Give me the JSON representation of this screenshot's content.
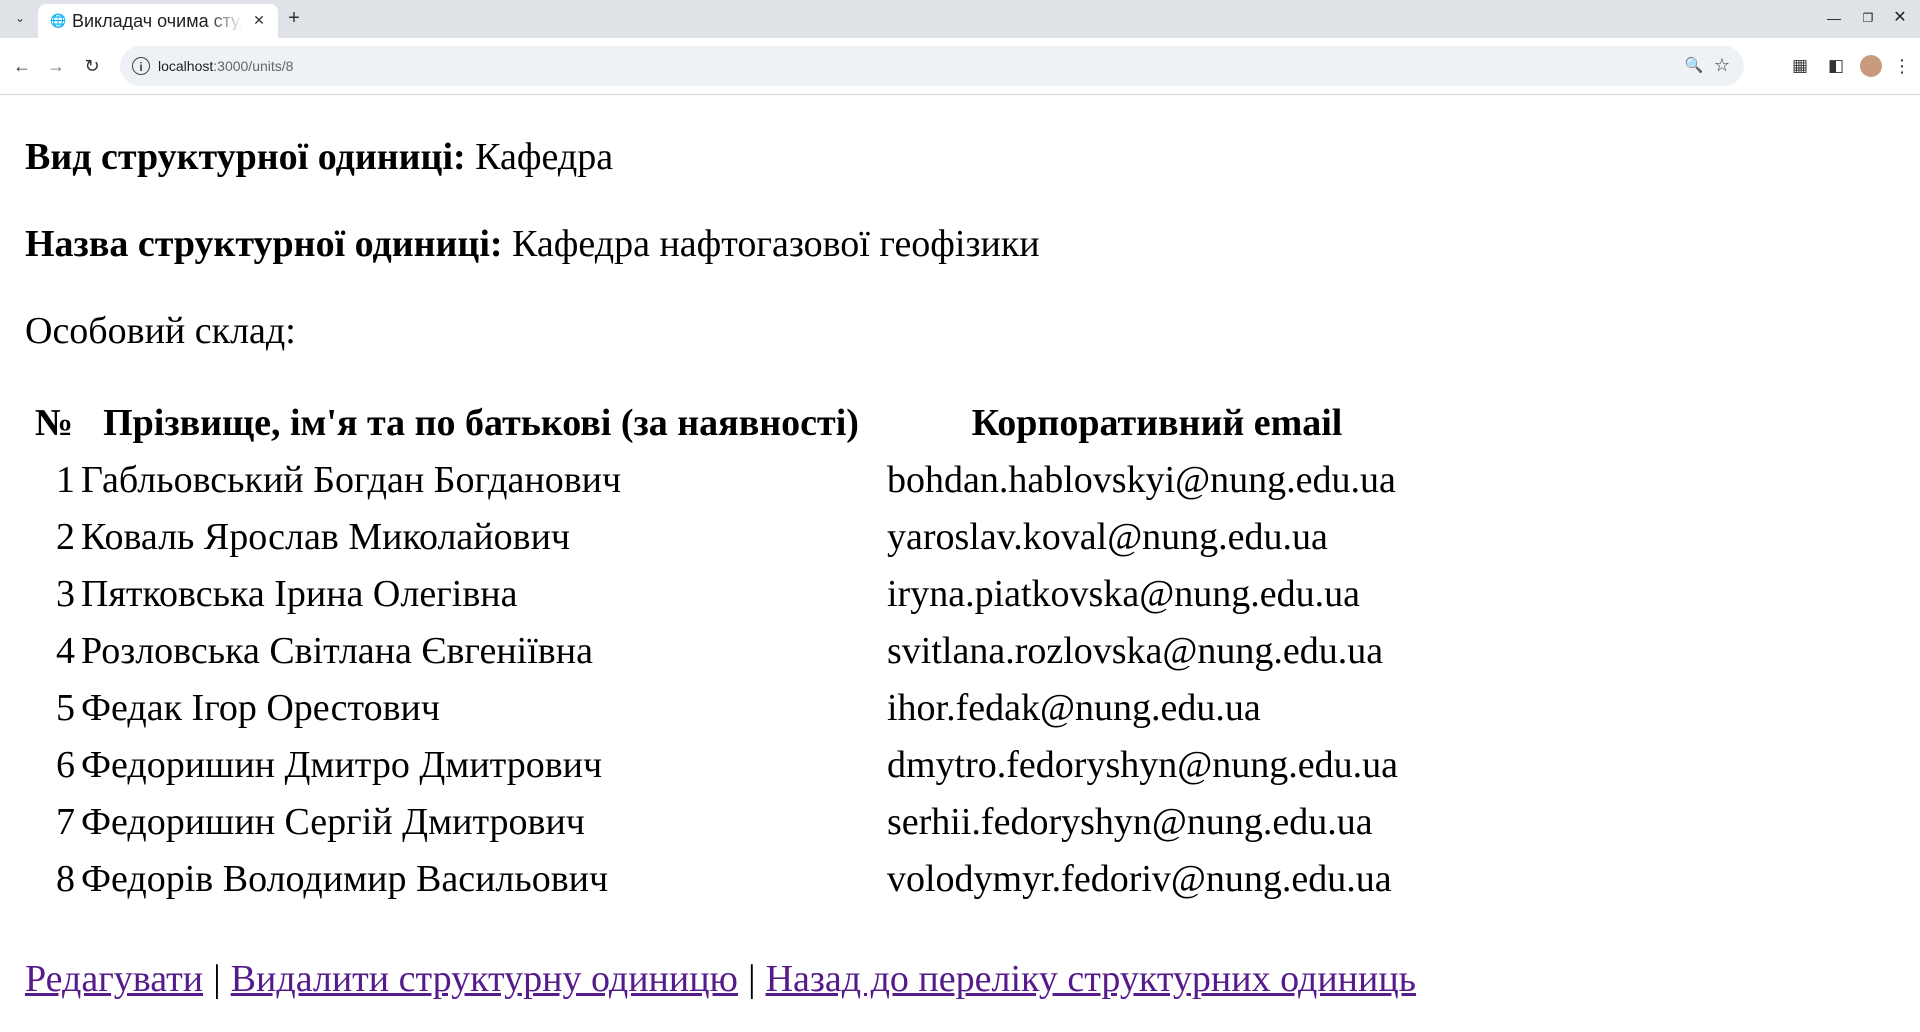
{
  "browser": {
    "tab_title": "Викладач очима студента",
    "url_host": "localhost",
    "url_path": ":3000/units/8",
    "icons": {
      "tab_list": "chevron-down-icon",
      "favicon": "globe-icon",
      "close": "close-icon",
      "new_tab": "plus-icon",
      "back": "arrow-left-icon",
      "forward": "arrow-right-icon",
      "reload": "reload-icon",
      "site_info": "info-icon",
      "zoom": "zoom-icon",
      "bookmark": "star-icon",
      "extensions": "puzzle-icon",
      "side_panel": "side-panel-icon",
      "profile": "avatar",
      "menu": "kebab-menu-icon"
    }
  },
  "unit": {
    "type_label": "Вид структурної одиниці:",
    "type_value": "Кафедра",
    "name_label": "Назва структурної одиниці:",
    "name_value": "Кафедра нафтогазової геофізики",
    "staff_heading": "Особовий склад:"
  },
  "staff_table": {
    "headers": {
      "num": "№",
      "name": "Прізвище, ім'я та по батькові (за наявності)",
      "email": "Корпоративний email"
    },
    "rows": [
      {
        "num": "1",
        "name": "Габльовський Богдан Богданович",
        "email": "bohdan.hablovskyi@nung.edu.ua"
      },
      {
        "num": "2",
        "name": "Коваль Ярослав Миколайович",
        "email": "yaroslav.koval@nung.edu.ua"
      },
      {
        "num": "3",
        "name": "Пятковська Ірина Олегівна",
        "email": "iryna.piatkovska@nung.edu.ua"
      },
      {
        "num": "4",
        "name": "Розловська Світлана Євгеніївна",
        "email": "svitlana.rozlovska@nung.edu.ua"
      },
      {
        "num": "5",
        "name": "Федак Ігор Орестович",
        "email": "ihor.fedak@nung.edu.ua"
      },
      {
        "num": "6",
        "name": "Федоришин Дмитро Дмитрович",
        "email": "dmytro.fedoryshyn@nung.edu.ua"
      },
      {
        "num": "7",
        "name": "Федоришин Сергій Дмитрович",
        "email": "serhii.fedoryshyn@nung.edu.ua"
      },
      {
        "num": "8",
        "name": "Федорів Володимир Васильович",
        "email": "volodymyr.fedoriv@nung.edu.ua"
      }
    ]
  },
  "links": {
    "edit": "Редагувати",
    "delete": "Видалити структурну одиницю",
    "back": "Назад до переліку структурних одиниць",
    "separator": "|"
  },
  "colors": {
    "link_visited": "#551a8b",
    "tabbar_bg": "#dfe3e8",
    "omnibox_bg": "#eef1f5"
  }
}
